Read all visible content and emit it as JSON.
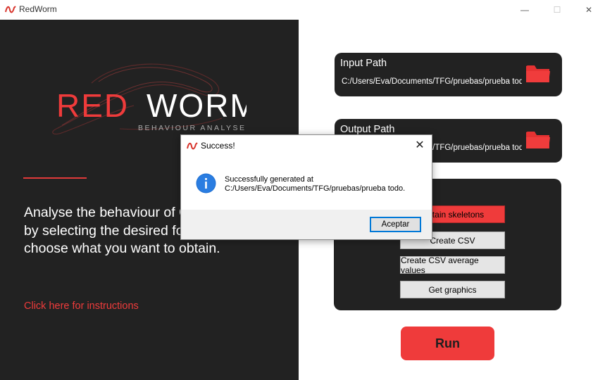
{
  "window": {
    "title": "RedWorm",
    "minimize": "—",
    "maximize": "☐",
    "close": "✕"
  },
  "left": {
    "logo_text_red": "RED",
    "logo_text_white": "WORM",
    "logo_subtitle": "BEHAVIOUR ANALYSER",
    "description": "Analyse the behaviour of C.elegans by selecting the desired folder and choose what you want to obtain.",
    "instructions_link": "Click here for instructions"
  },
  "input_path": {
    "label": "Input Path",
    "value": "C:/Users/Eva/Documents/TFG/pruebas/prueba todo"
  },
  "output_path": {
    "label": "Output Path",
    "value": "C:/Users/Eva/Documents/TFG/pruebas/prueba todo"
  },
  "options": {
    "buttons": [
      {
        "label": "Obtain skeletons",
        "active": true
      },
      {
        "label": "Create CSV",
        "active": false
      },
      {
        "label": "Create CSV average values",
        "active": false
      },
      {
        "label": "Get graphics",
        "active": false
      }
    ]
  },
  "run_button": "Run",
  "dialog": {
    "title": "Success!",
    "message_line1": "Successfully generated at",
    "message_line2": "C:/Users/Eva/Documents/TFG/pruebas/prueba todo.",
    "ok_label": "Aceptar",
    "close": "✕"
  },
  "colors": {
    "accent": "#ef3b3b",
    "panel": "#222222",
    "background": "#ffffff"
  }
}
